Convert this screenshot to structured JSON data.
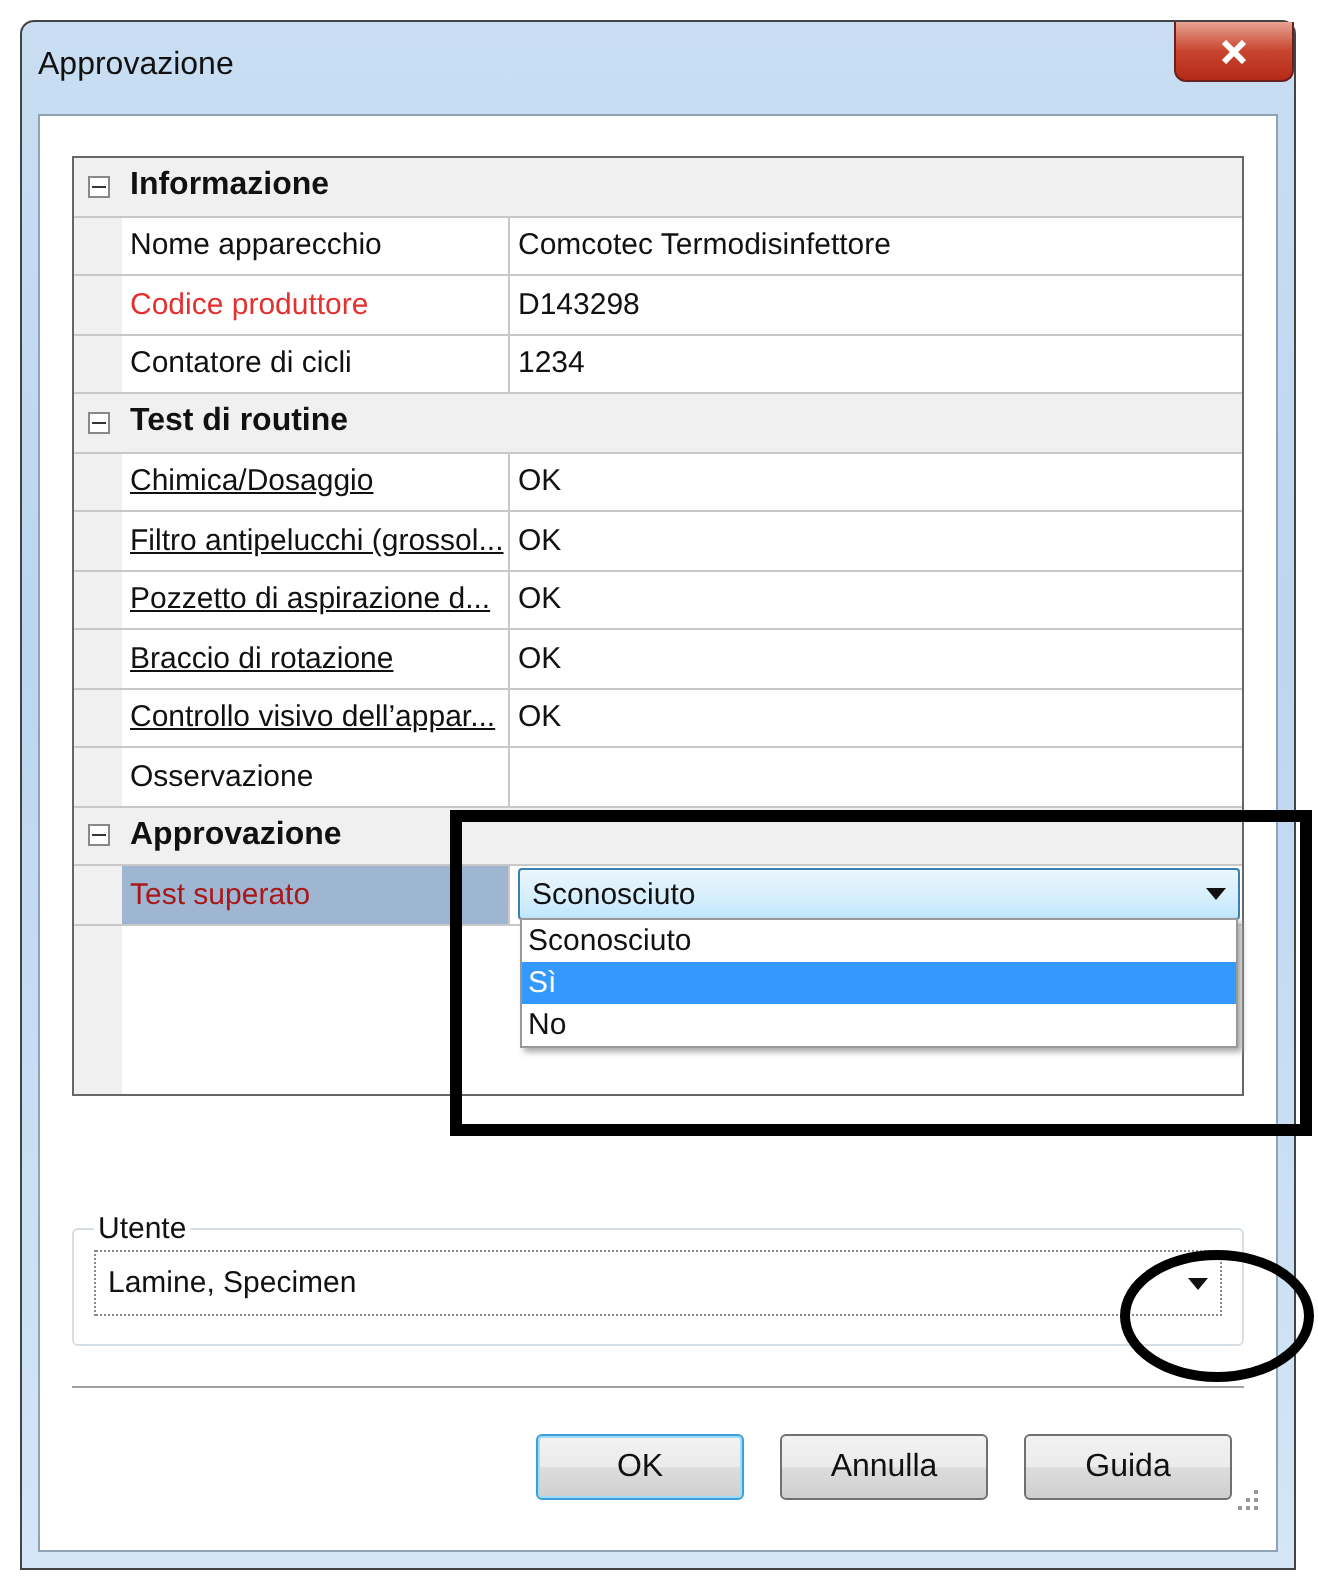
{
  "window": {
    "title": "Approvazione"
  },
  "sections": [
    {
      "title": "Informazione",
      "expanded": true,
      "rows": [
        {
          "name": "Nome apparecchio",
          "value": "Comcotec Termodisinfettore",
          "kind": "text",
          "required": false,
          "selected": false
        },
        {
          "name": "Codice produttore",
          "value": "D143298",
          "kind": "text",
          "required": true,
          "selected": false
        },
        {
          "name": "Contatore di cicli",
          "value": "1234",
          "kind": "text",
          "required": false,
          "selected": false
        }
      ]
    },
    {
      "title": "Test di routine",
      "expanded": true,
      "rows": [
        {
          "name": "Chimica/Dosaggio",
          "value": "OK",
          "kind": "link",
          "required": false,
          "selected": false
        },
        {
          "name": "Filtro antipelucchi (grossol...",
          "value": "OK",
          "kind": "link",
          "required": false,
          "selected": false
        },
        {
          "name": "Pozzetto di aspirazione d...",
          "value": "OK",
          "kind": "link",
          "required": false,
          "selected": false
        },
        {
          "name": "Braccio di rotazione",
          "value": "OK",
          "kind": "link",
          "required": false,
          "selected": false
        },
        {
          "name": "Controllo visivo dell’appar...",
          "value": "OK",
          "kind": "link",
          "required": false,
          "selected": false
        },
        {
          "name": "Osservazione",
          "kind": "text",
          "required": false,
          "selected": false
        }
      ]
    },
    {
      "title": "Approvazione",
      "expanded": true,
      "rows": [
        {
          "name": "Test superato",
          "value": "Sconosciuto",
          "kind": "dropdown",
          "required": true,
          "selected": true,
          "expanded": true,
          "options": [
            {
              "label": "Sconosciuto",
              "highlighted": false
            },
            {
              "label": "Sì",
              "highlighted": true
            },
            {
              "label": "No",
              "highlighted": false
            }
          ]
        }
      ]
    }
  ],
  "user": {
    "label": "Utente",
    "value": "Lamine, Specimen"
  },
  "buttons": [
    {
      "label": "OK",
      "default": true
    },
    {
      "label": "Annulla",
      "default": false
    },
    {
      "label": "Guida",
      "default": false
    }
  ]
}
